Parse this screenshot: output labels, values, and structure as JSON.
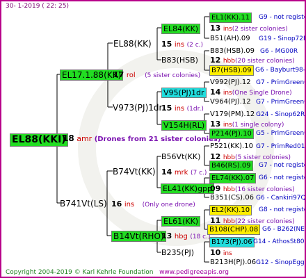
{
  "header": "30-   1-2019  (  22:  25)",
  "footer": {
    "copyright": "Copyright 2004-2019 © Karl Kehrle Foundation",
    "url": "www.pedigreeapis.org"
  },
  "root": {
    "id": "EL88(KKI)",
    "gen": "18",
    "suffix": "amr",
    "note": "(Drones from 21 sister colonies)"
  },
  "n_el17": {
    "id": "EL17.1.88(KK)",
    "gen": "17",
    "suffix": "rol",
    "note": "(5 sister colonies)"
  },
  "n_b741": {
    "id": "B741Vt(LS)",
    "gen": "16",
    "suffix": "ins",
    "note": "(Only one drone)"
  },
  "n_el88kk": {
    "id": "EL88(KK)",
    "gen": "15",
    "suffix": "ins",
    "note": "(2 c.)"
  },
  "n_v973": {
    "id": "V973(PJ)1dr",
    "gen": "15",
    "suffix": "ins",
    "note": "(1dr.)"
  },
  "n_b74vt": {
    "id": "B74Vt(KK)",
    "gen": "14",
    "suffix": "mrk",
    "note": "(7 c.)"
  },
  "n_b14vt": {
    "id": "B14Vt(RHO)",
    "gen": "13",
    "suffix": "hbg",
    "note": "(18 c.)"
  },
  "n_el84": {
    "id": "EL84(KK)",
    "gen": "13",
    "suffix": "ins",
    "note": "(2 sister colonies)"
  },
  "n_b83": {
    "id": "B83(HSB)",
    "gen": "12",
    "suffix": "hbb",
    "note": "(20 sister colonies)"
  },
  "n_v95": {
    "id": "V95(PJ)1dr",
    "gen": "14",
    "suffix": "ins",
    "note": "(One Single Drone)"
  },
  "n_v154": {
    "id": "V154H(RL)",
    "gen": "13",
    "suffix": "ins",
    "note": "(1 single colony)"
  },
  "n_b56": {
    "id": "B56Vt(KK)",
    "gen": "12",
    "suffix": "hbb",
    "note": "(5 sister colonies)"
  },
  "n_el41": {
    "id": "EL41(KK)gpp",
    "gen": "09",
    "suffix": "hbb",
    "note": "(16 sister colonies)"
  },
  "n_el61": {
    "id": "EL61(KK)",
    "gen": "11",
    "suffix": "hbb",
    "note": "(22 sister colonies)"
  },
  "n_b235": {
    "id": "B235(PJ)",
    "gen": "10",
    "suffix": "ins",
    "note": ""
  },
  "leaves": [
    {
      "id": "EL1(KK).11",
      "info": "G9 - not registe"
    },
    {
      "id": "B51(AH).09",
      "info": "G19 - Sinop72R"
    },
    {
      "id": "B83(HSB).09",
      "info": "G6 - MG00R"
    },
    {
      "id": "B7(HSB).09",
      "info": "G6 - Bayburt98-3"
    },
    {
      "id": "V992(PJ).12",
      "info": "G7 - PrimGreen00"
    },
    {
      "id": "V964(PJ).12",
      "info": "G7 - PrimGreen00"
    },
    {
      "id": "V179(PM).12",
      "info": "G24 - Sinop62R"
    },
    {
      "id": "P214(PJ).10",
      "info": "G5 - PrimGreen00"
    },
    {
      "id": "P521(KK).10",
      "info": "G7 - PrimRed01"
    },
    {
      "id": "B46(RS).09",
      "info": "G7 - not registe"
    },
    {
      "id": "EL74(KK).07",
      "info": "G6 - not registe"
    },
    {
      "id": "B351(CS).06",
      "info": "G6 - Cankiri97Q"
    },
    {
      "id": "EL2(KK).10",
      "info": "G8 - not registe"
    },
    {
      "id": "B108(CHP).08",
      "info": "G6 - B262(NE)"
    },
    {
      "id": "B173(PJ).06",
      "info": "G14 - AthosSt80R"
    },
    {
      "id": "B213H(PJ).06",
      "info": "G12 - SinopEgg86R"
    }
  ],
  "colors": {
    "frame": "#b8008a",
    "green": "#22dd22",
    "yellow": "#ffee00",
    "cyan": "#22dddd",
    "lines": "#000000"
  }
}
